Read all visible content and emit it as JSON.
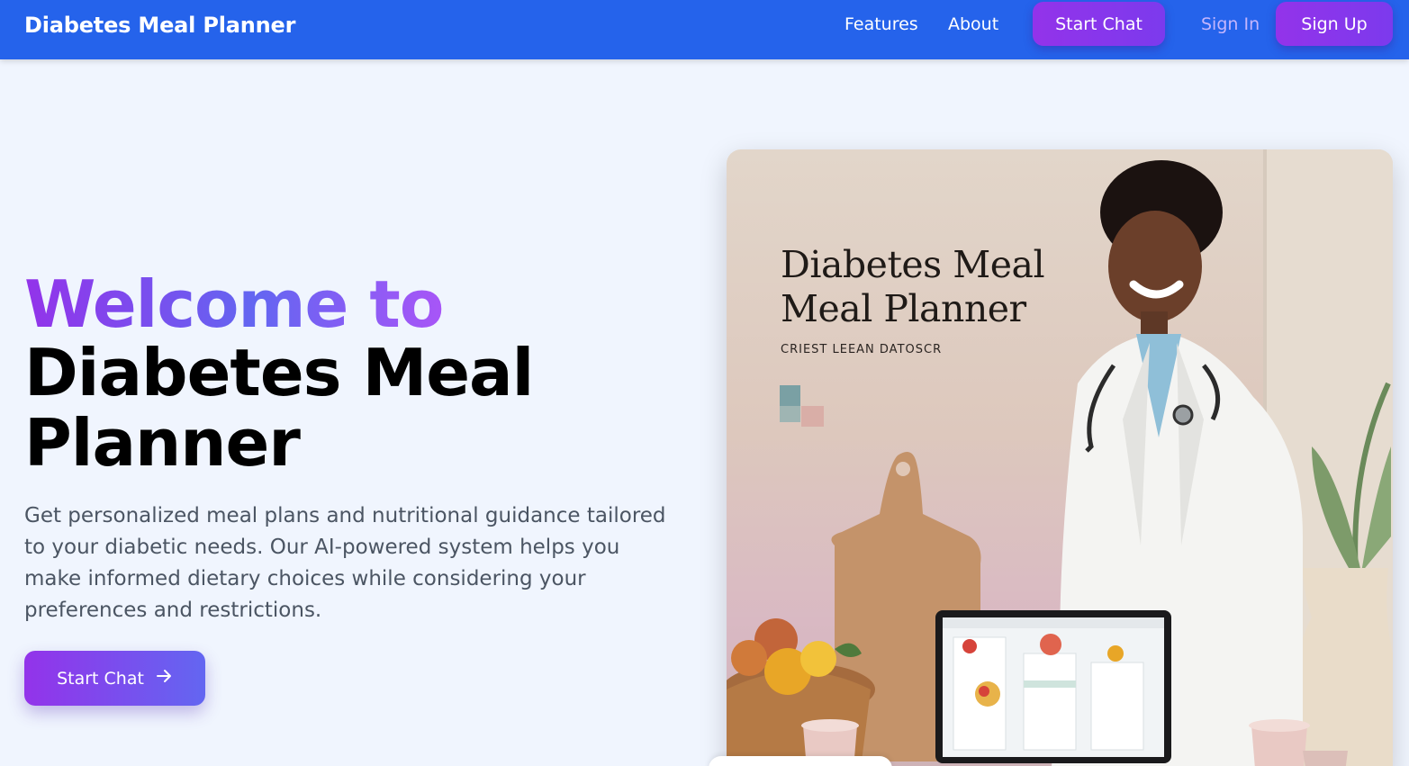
{
  "nav": {
    "brand": "Diabetes Meal Planner",
    "features": "Features",
    "about": "About",
    "start_chat": "Start Chat",
    "sign_in": "Sign In",
    "sign_up": "Sign Up"
  },
  "hero": {
    "line1": "Welcome to",
    "line2": "Diabetes Meal",
    "line3": "Planner",
    "description": "Get personalized meal plans and nutritional guidance tailored to your diabetic needs. Our AI-powered system helps you make informed dietary choices while considering your preferences and restrictions.",
    "cta_label": "Start Chat"
  },
  "image": {
    "title_line1": "Diabetes Meal",
    "title_line2": "Meal Planner",
    "subtitle": "CRIEST LEEAN DATOSCR"
  },
  "colors": {
    "nav_bg": "#2563eb",
    "accent_purple": "#9333ea",
    "accent_indigo": "#6366f1",
    "page_bg": "#f0f5fe"
  }
}
